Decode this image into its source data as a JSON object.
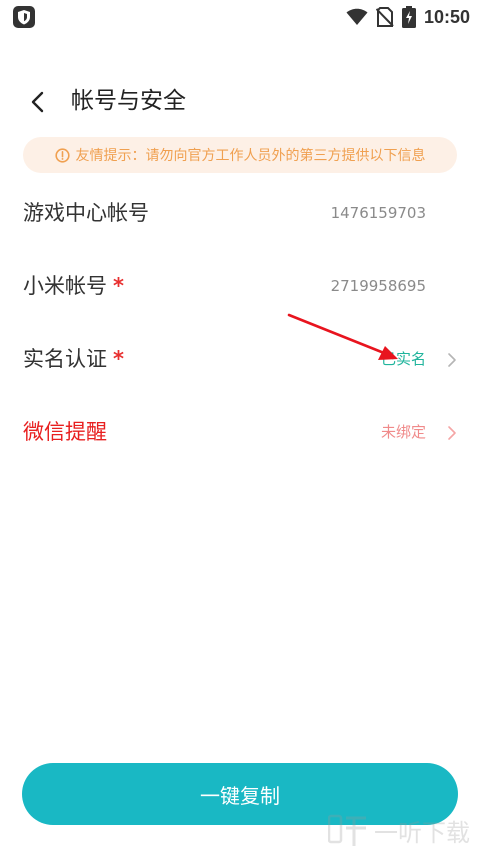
{
  "status_bar": {
    "time": "10:50",
    "icons": [
      "shield-icon",
      "wifi-icon",
      "no-sim-icon",
      "battery-charging-icon"
    ]
  },
  "header": {
    "back_icon": "chevron-left-icon",
    "title": "帐号与安全"
  },
  "notice": {
    "icon": "info-circle-icon",
    "text": "友情提示：请勿向官方工作人员外的第三方提供以下信息",
    "color": "#f0a050"
  },
  "rows": [
    {
      "label": "游戏中心帐号",
      "required": false,
      "value": "1476159703"
    },
    {
      "label": "小米帐号",
      "required": true,
      "required_mark": "*",
      "value": "2719958695"
    },
    {
      "label": "实名认证",
      "required": true,
      "required_mark": "*",
      "value": "已实名",
      "value_color": "#1fb49c"
    },
    {
      "label": "微信提醒",
      "required": false,
      "value": "未绑定",
      "label_color": "#e82020",
      "value_color": "#f08a8a"
    }
  ],
  "copy_button": {
    "label": "一键复制",
    "color": "#19b8c4"
  },
  "watermark": {
    "text": "一听下载"
  }
}
